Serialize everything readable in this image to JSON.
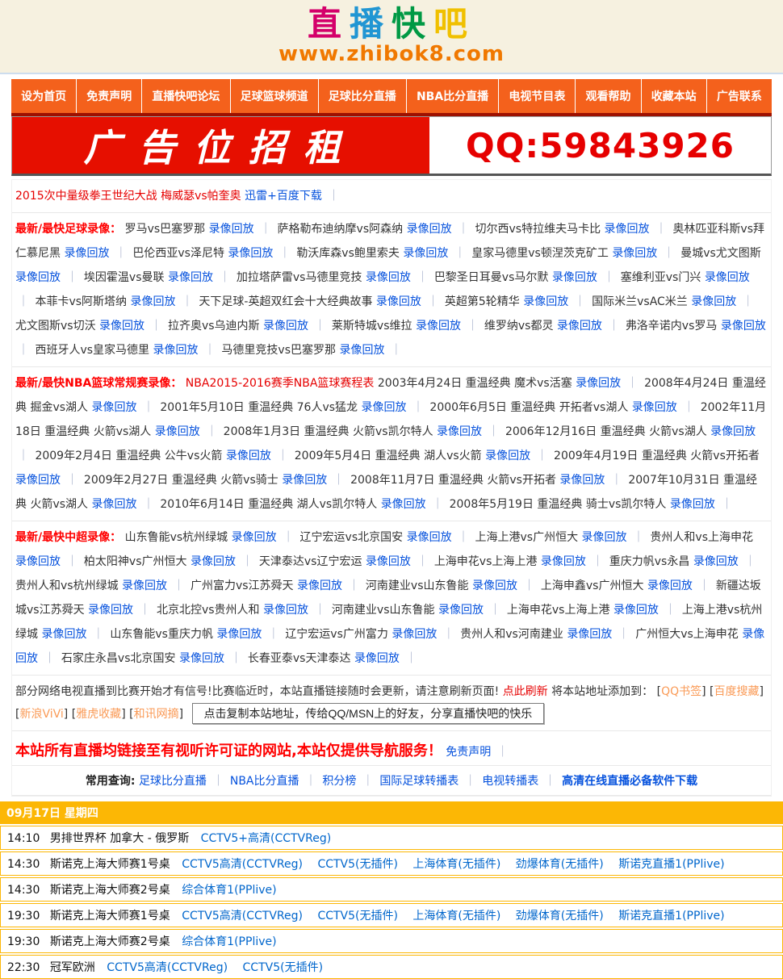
{
  "colors": {
    "nav_bg": "#f4611c",
    "nav_underline": "#9e1000",
    "banner_red": "#e60f00",
    "accent_red": "#ff0000",
    "link_blue": "#0652dd",
    "channel_blue": "#0066cc",
    "bookmark_orange": "#fa9a56",
    "gold": "#fcb705",
    "header_bg": "#f6f1e0",
    "logo_colors": [
      "#d4006a",
      "#2196d3",
      "#009944",
      "#f0c000"
    ],
    "url_orange": "#f07800"
  },
  "header": {
    "logo_chars": {
      "c1": "直",
      "c2": "播",
      "c3": "快",
      "c4": "吧"
    },
    "url": "www.zhibok8.com"
  },
  "nav": {
    "items": [
      "设为首页",
      "免责声明",
      "直播快吧论坛",
      "足球篮球频道",
      "足球比分直播",
      "NBA比分直播",
      "电视节目表",
      "观看帮助",
      "收藏本站",
      "广告联系"
    ]
  },
  "banner": {
    "text": "广告位招租",
    "qq": "QQ:59843926"
  },
  "labels": {
    "replay": "录像回放",
    "sep": "｜",
    "bracket_open": "[",
    "bracket_close": "]"
  },
  "ticker": {
    "text": "2015次中量级拳王世纪大战 梅威瑟vs帕奎奥",
    "link": "迅雷+百度下载"
  },
  "sections": {
    "football": {
      "header": "最新/最快足球录像：",
      "items": [
        "罗马vs巴塞罗那",
        "萨格勒布迪纳摩vs阿森纳",
        "切尔西vs特拉维夫马卡比",
        "奥林匹亚科斯vs拜仁慕尼黑",
        "巴伦西亚vs泽尼特",
        "勒沃库森vs鲍里索夫",
        "皇家马德里vs顿涅茨克矿工",
        "曼城vs尤文图斯",
        "埃因霍温vs曼联",
        "加拉塔萨雷vs马德里竞技",
        "巴黎圣日耳曼vs马尔默",
        "塞维利亚vs门兴",
        "本菲卡vs阿斯塔纳",
        "天下足球-英超双红会十大经典故事",
        "英超第5轮精华",
        "国际米兰vsAC米兰",
        "尤文图斯vs切沃",
        "拉齐奥vs乌迪内斯",
        "莱斯特城vs维拉",
        "维罗纳vs都灵",
        "弗洛辛诺内vs罗马",
        "西班牙人vs皇家马德里",
        "马德里竞技vs巴塞罗那"
      ]
    },
    "nba": {
      "header": "最新/最快NBA篮球常规赛录像：",
      "schedule_link": "NBA2015-2016赛季NBA篮球赛程表",
      "items": [
        "2003年4月24日 重温经典 魔术vs活塞",
        "2008年4月24日 重温经典 掘金vs湖人",
        "2001年5月10日 重温经典 76人vs猛龙",
        "2000年6月5日 重温经典 开拓者vs湖人",
        "2002年11月18日 重温经典 火箭vs湖人",
        "2008年1月3日 重温经典 火箭vs凯尔特人",
        "2006年12月16日 重温经典 火箭vs湖人",
        "2009年2月4日 重温经典 公牛vs火箭",
        "2009年5月4日 重温经典 湖人vs火箭",
        "2009年4月19日 重温经典 火箭vs开拓者",
        "2009年2月27日 重温经典 火箭vs骑士",
        "2008年11月7日 重温经典 火箭vs开拓者",
        "2007年10月31日 重温经典 火箭vs湖人",
        "2010年6月14日 重温经典 湖人vs凯尔特人",
        "2008年5月19日 重温经典 骑士vs凯尔特人"
      ]
    },
    "csl": {
      "header": "最新/最快中超录像：",
      "items": [
        "山东鲁能vs杭州绿城",
        "辽宁宏运vs北京国安",
        "上海上港vs广州恒大",
        "贵州人和vs上海申花",
        "柏太阳神vs广州恒大",
        "天津泰达vs辽宁宏运",
        "上海申花vs上海上港",
        "重庆力帆vs永昌",
        "贵州人和vs杭州绿城",
        "广州富力vs江苏舜天",
        "河南建业vs山东鲁能",
        "上海申鑫vs广州恒大",
        "新疆达坂城vs江苏舜天",
        "北京北控vs贵州人和",
        "河南建业vs山东鲁能",
        "上海申花vs上海上港",
        "上海上港vs杭州绿城",
        "山东鲁能vs重庆力帆",
        "辽宁宏运vs广州富力",
        "贵州人和vs河南建业",
        "广州恒大vs上海申花",
        "石家庄永昌vs北京国安",
        "长春亚泰vs天津泰达"
      ]
    }
  },
  "notice": {
    "text1": "部分网络电视直播到比赛开始才有信号!比赛临近时，本站直播链接随时会更新，请注意刷新页面!",
    "refresh_link": "点此刷新",
    "text2": " 将本站地址添加到：",
    "bookmarks": [
      "QQ书签",
      "百度搜藏",
      "新浪ViVi",
      "雅虎收藏",
      "和讯网摘"
    ],
    "copy_button": "点击复制本站地址，传给QQ/MSN上的好友，分享直播快吧的快乐"
  },
  "disclaimer": {
    "text": "本站所有直播均链接至有视听许可证的网站,本站仅提供导航服务！",
    "link": "免责声明"
  },
  "queries": {
    "label": "常用查询:",
    "links": [
      "足球比分直播",
      "NBA比分直播",
      "积分榜",
      "国际足球转播表",
      "电视转播表"
    ],
    "bold_link": "高清在线直播必备软件下载"
  },
  "schedule": {
    "date": "09月17日 星期四",
    "rows": [
      {
        "time": "14:10",
        "event": "男排世界杯 加拿大 - 俄罗斯",
        "channels": [
          "CCTV5+高清(CCTVReg)"
        ]
      },
      {
        "time": "14:30",
        "event": "斯诺克上海大师赛1号桌",
        "channels": [
          "CCTV5高清(CCTVReg)",
          "CCTV5(无插件)",
          "上海体育(无插件)",
          "劲爆体育(无插件)",
          "斯诺克直播1(PPlive)"
        ]
      },
      {
        "time": "14:30",
        "event": "斯诺克上海大师赛2号桌",
        "channels": [
          "综合体育1(PPlive)"
        ]
      },
      {
        "time": "19:30",
        "event": "斯诺克上海大师赛1号桌",
        "channels": [
          "CCTV5高清(CCTVReg)",
          "CCTV5(无插件)",
          "上海体育(无插件)",
          "劲爆体育(无插件)",
          "斯诺克直播1(PPlive)"
        ]
      },
      {
        "time": "19:30",
        "event": "斯诺克上海大师赛2号桌",
        "channels": [
          "综合体育1(PPlive)"
        ]
      },
      {
        "time": "22:30",
        "event": "冠军欧洲",
        "channels": [
          "CCTV5高清(CCTVReg)",
          "CCTV5(无插件)"
        ]
      }
    ]
  }
}
